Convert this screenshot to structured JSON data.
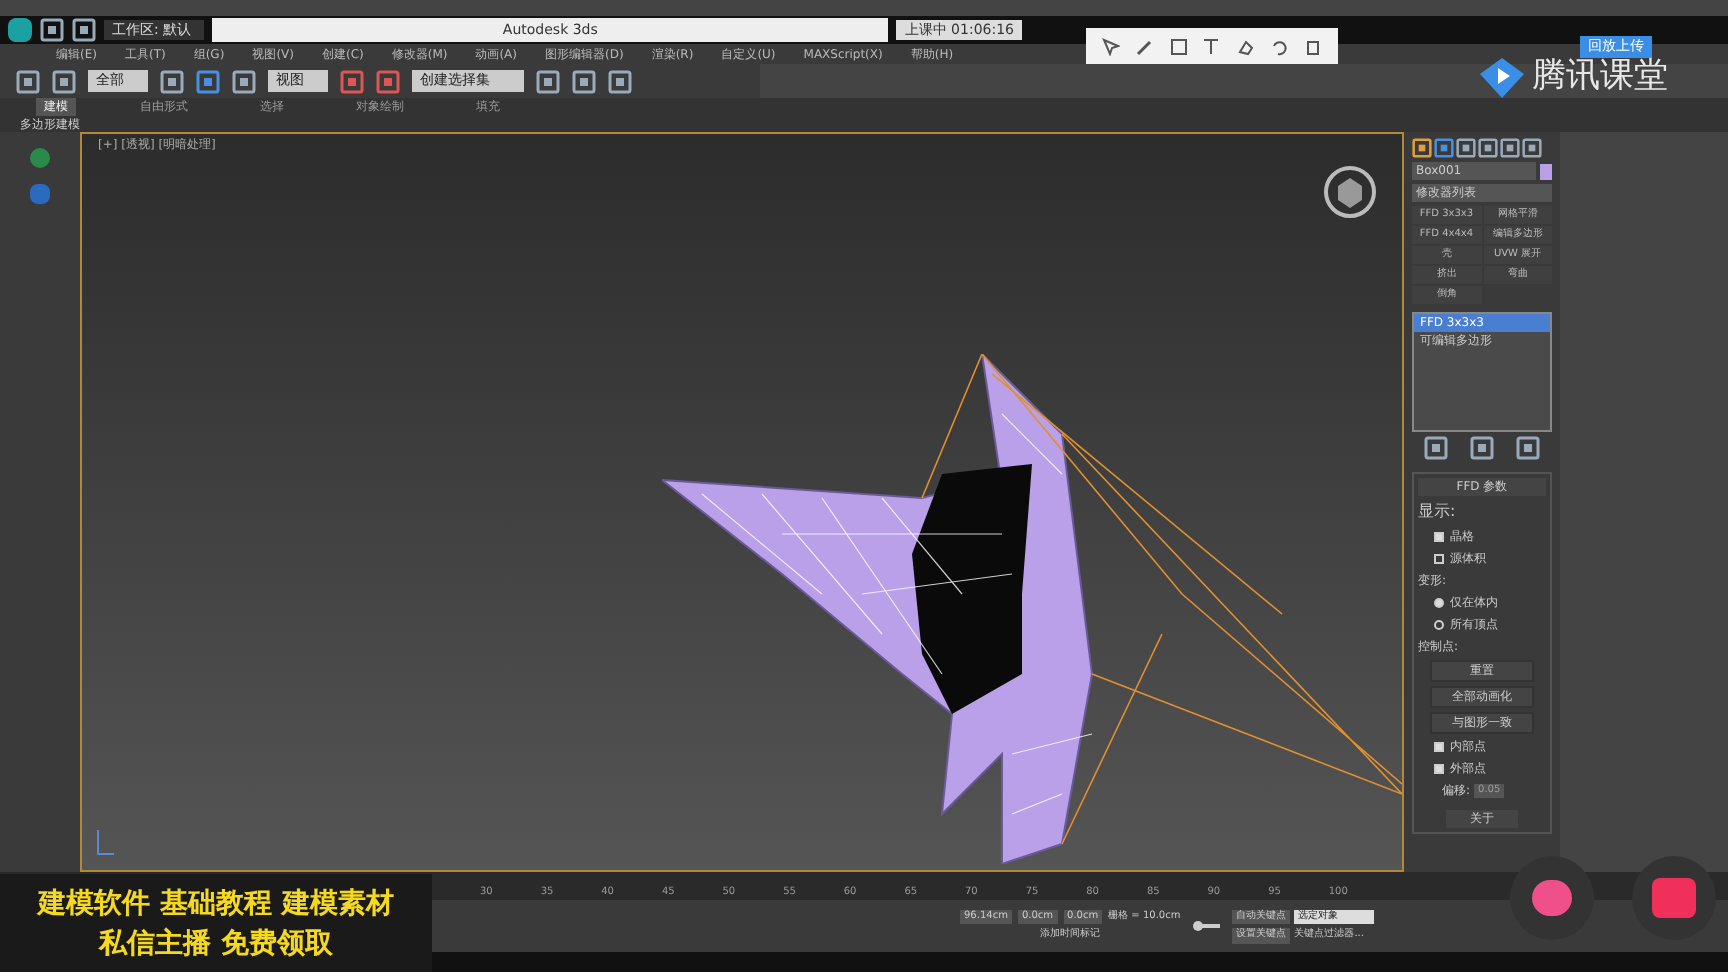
{
  "window": {
    "workspace": "工作区: 默认",
    "title": "Autodesk 3ds",
    "recorder": "上课中 01:06:16"
  },
  "menu": [
    "编辑(E)",
    "工具(T)",
    "组(G)",
    "视图(V)",
    "创建(C)",
    "修改器(M)",
    "动画(A)",
    "图形编辑器(D)",
    "渲染(R)",
    "自定义(U)",
    "MAXScript(X)",
    "帮助(H)"
  ],
  "toolbar": {
    "selection_filter": "全部",
    "coordinate": "视图",
    "named_selection": "创建选择集"
  },
  "ribbon": {
    "tabs": [
      {
        "label": "建模",
        "selected": true
      },
      {
        "label": "自由形式",
        "selected": false
      },
      {
        "label": "选择",
        "selected": false
      },
      {
        "label": "对象绘制",
        "selected": false
      },
      {
        "label": "填充",
        "selected": false
      }
    ],
    "subtitle": "多边形建模"
  },
  "viewport": {
    "label": "[+] [透视] [明暗处理]"
  },
  "overlay": {
    "brand": "腾讯课堂",
    "upload": "回放上传",
    "caption_lines": [
      "建模软件 基础教程 建模素材",
      "私信主播 免费领取"
    ]
  },
  "command_panel": {
    "object_name": "Box001",
    "modifier_list": "修改器列表",
    "modifier_buttons": [
      "FFD 3x3x3",
      "网格平滑",
      "FFD 4x4x4",
      "编辑多边形",
      "壳",
      "UVW 展开",
      "挤出",
      "弯曲",
      "倒角"
    ],
    "stack": [
      {
        "label": "FFD 3x3x3",
        "selected": true
      },
      {
        "label": "可编辑多边形",
        "selected": false
      }
    ],
    "rollout": {
      "title": "FFD 参数",
      "display_title": "显示:",
      "display": [
        {
          "label": "晶格",
          "checked": true
        },
        {
          "label": "源体积",
          "checked": false
        }
      ],
      "deform_title": "变形:",
      "deform": [
        {
          "label": "仅在体内",
          "selected": true
        },
        {
          "label": "所有顶点",
          "selected": false
        }
      ],
      "control_title": "控制点:",
      "buttons": [
        "重置",
        "全部动画化",
        "与图形一致"
      ],
      "options": [
        {
          "label": "内部点",
          "checked": true
        },
        {
          "label": "外部点",
          "checked": true
        }
      ],
      "offset_label": "偏移:",
      "offset_value": "0.05",
      "about": "关于"
    }
  },
  "timeline": {
    "ticks": [
      "30",
      "35",
      "40",
      "45",
      "50",
      "55",
      "60",
      "65",
      "70",
      "75",
      "80",
      "85",
      "90",
      "95",
      "100"
    ]
  },
  "status": {
    "x": "96.14cm",
    "y": "0.0cm",
    "z": "0.0cm",
    "grid": "栅格 = 10.0cm",
    "add_marker": "添加时间标记",
    "auto_key": "自动关键点",
    "set_key": "设置关键点",
    "selected": "选定对象",
    "key_filter": "关键点过滤器..."
  }
}
